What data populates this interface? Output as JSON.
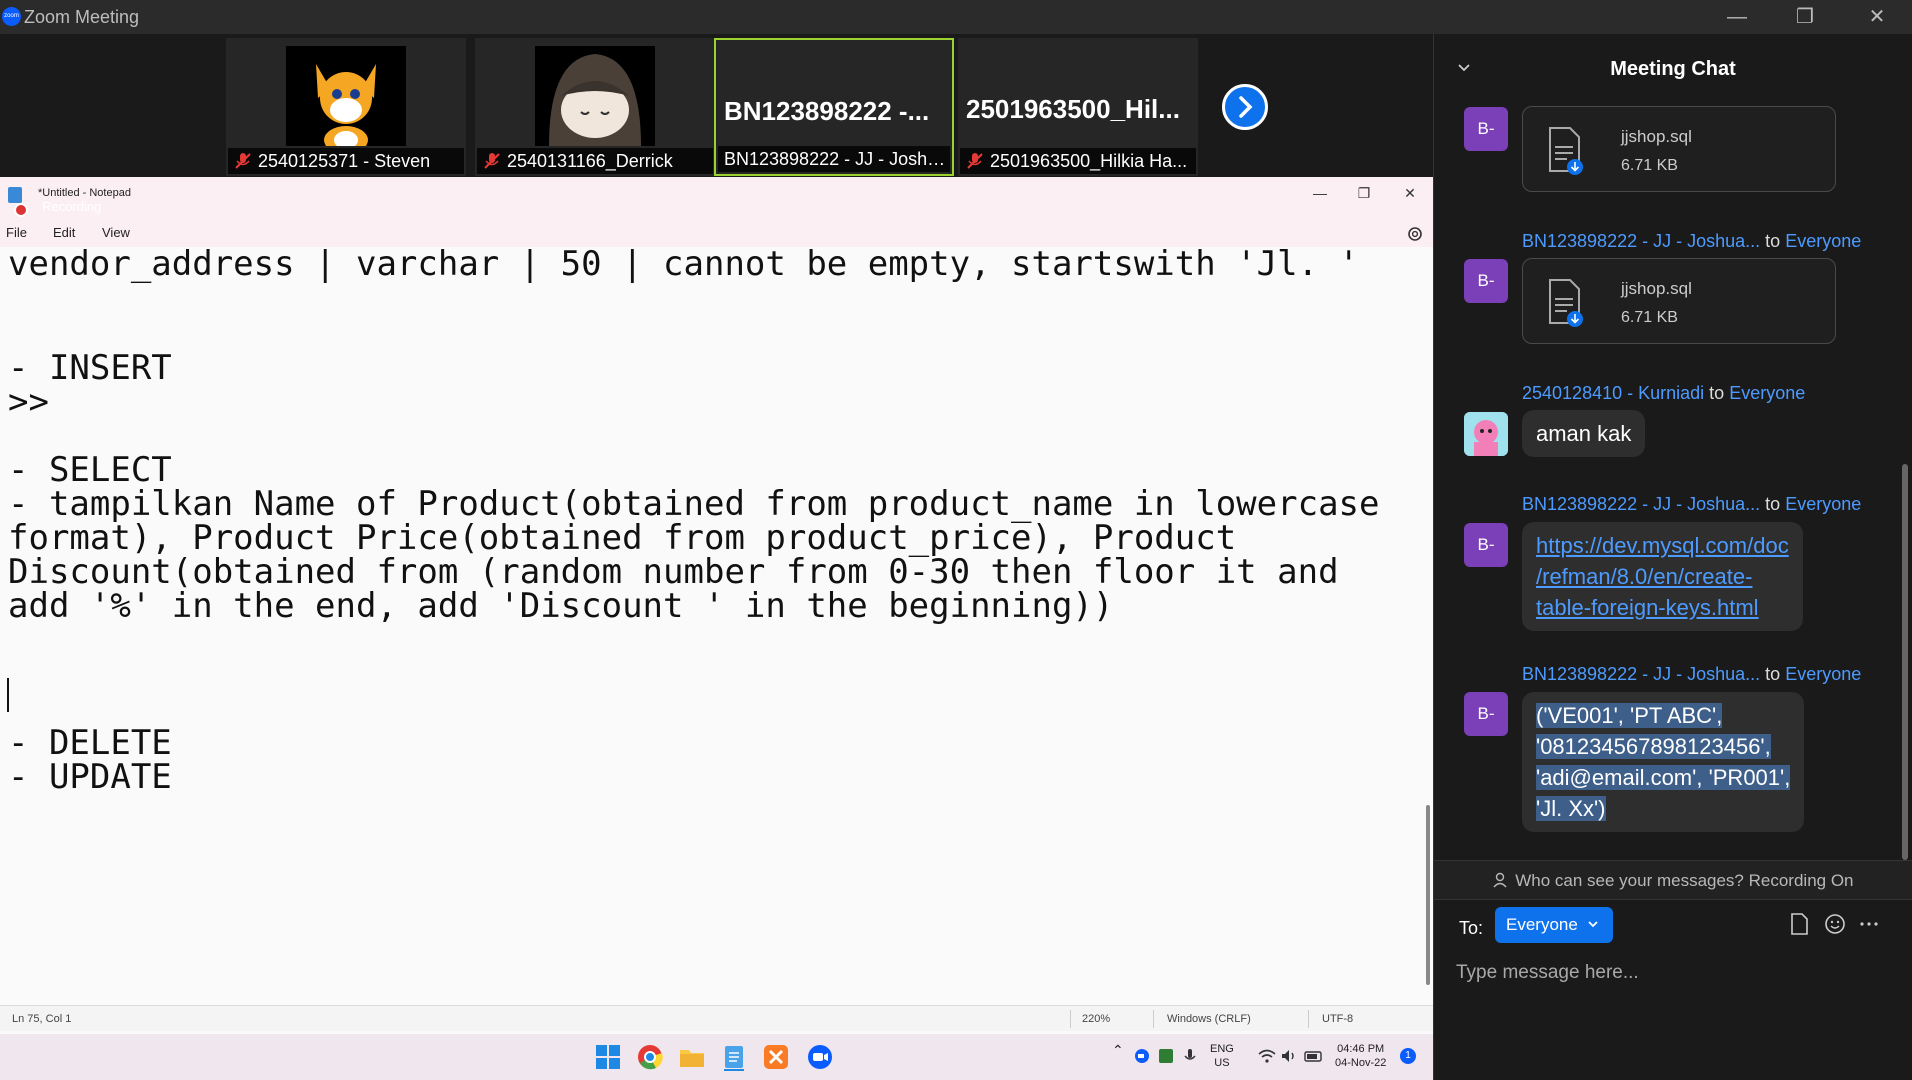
{
  "zoom": {
    "logo": "zoom",
    "title": "Zoom Meeting"
  },
  "participants": [
    {
      "label": "2540125371 - Steven",
      "muted": true
    },
    {
      "label": "2540131166_Derrick",
      "muted": true
    },
    {
      "display_name": "BN123898222  -...",
      "label": "BN123898222 - JJ - Joshu...",
      "muted": false,
      "active": true
    },
    {
      "display_name": "2501963500_Hil...",
      "label": "2501963500_Hilkia Ha...",
      "muted": true
    }
  ],
  "notepad": {
    "title": "*Untitled - Notepad",
    "recording_text": "Recording",
    "menu": {
      "file": "File",
      "edit": "Edit",
      "view": "View"
    },
    "lines": [
      "vendor_address | varchar | 50 | cannot be empty, startswith 'Jl. '",
      "- INSERT",
      ">>",
      "- SELECT",
      "- tampilkan Name of Product(obtained from product_name in lowercase",
      "format), Product Price(obtained from product_price), Product",
      "Discount(obtained from (random number from 0-30 then floor it and",
      "add '%' in the end, add 'Discount ' in the beginning))",
      "- DELETE",
      "- UPDATE"
    ],
    "status": {
      "position": "Ln 75, Col 1",
      "zoom": "220%",
      "line_ending": "Windows (CRLF)",
      "encoding": "UTF-8"
    }
  },
  "taskbar": {
    "apps": [
      "windows-start",
      "chrome",
      "file-explorer",
      "notepad",
      "xampp",
      "zoom"
    ],
    "lang_top": "ENG",
    "lang_bottom": "US",
    "time": "04:46 PM",
    "date": "04-Nov-22",
    "notification_count": "1"
  },
  "chat": {
    "title": "Meeting Chat",
    "to_everyone": "to",
    "target": "Everyone",
    "messages": [
      {
        "avatar": "B-",
        "file_name": "jjshop.sql",
        "file_size": "6.71 KB"
      },
      {
        "avatar": "B-",
        "sender": "BN123898222 - JJ - Joshua...",
        "file_name": "jjshop.sql",
        "file_size": "6.71 KB"
      },
      {
        "sender": "2540128410 - Kurniadi",
        "text": "aman kak"
      },
      {
        "avatar": "B-",
        "sender": "BN123898222 - JJ - Joshua...",
        "link_lines": [
          "https://dev.mysql.com/doc",
          "/refman/8.0/en/create-",
          "table-foreign-keys.html"
        ]
      },
      {
        "avatar": "B-",
        "sender": "BN123898222 - JJ - Joshua...",
        "text_lines": [
          "('VE001', 'PT ABC',",
          "'081234567898123456',",
          "'adi@email.com', 'PR001',",
          "'Jl. Xx')"
        ]
      }
    ],
    "privacy_text": "Who can see your messages? Recording On",
    "to_label": "To:",
    "to_value": "Everyone",
    "input_placeholder": "Type message here..."
  }
}
